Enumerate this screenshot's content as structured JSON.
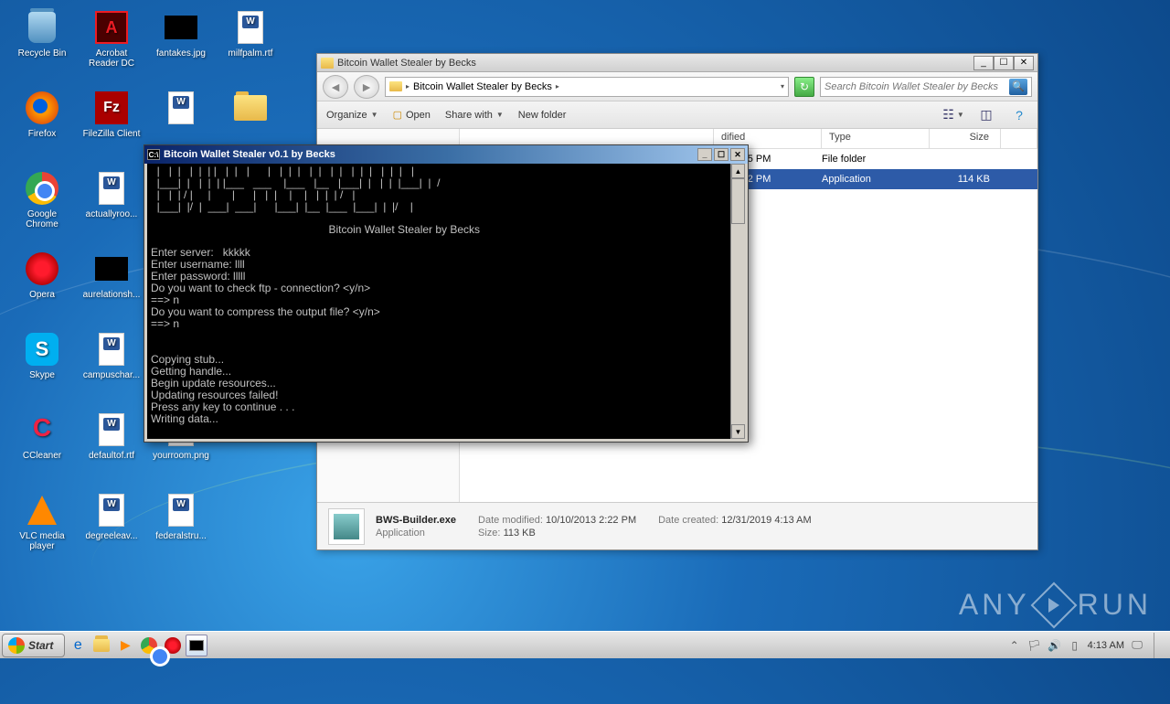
{
  "desktop": {
    "icons": [
      {
        "label": "Recycle Bin",
        "type": "recycle-bin"
      },
      {
        "label": "Acrobat Reader DC",
        "type": "adobe"
      },
      {
        "label": "fantakes.jpg",
        "type": "black"
      },
      {
        "label": "milfpalm.rtf",
        "type": "word"
      },
      {
        "label": "Firefox",
        "type": "firefox"
      },
      {
        "label": "FileZilla Client",
        "type": "filezilla"
      },
      {
        "label": "",
        "type": "word"
      },
      {
        "label": "",
        "type": "folder"
      },
      {
        "label": "Google Chrome",
        "type": "chrome"
      },
      {
        "label": "actuallyroo...",
        "type": "word"
      },
      {
        "label": "",
        "type": ""
      },
      {
        "label": "",
        "type": ""
      },
      {
        "label": "Opera",
        "type": "opera"
      },
      {
        "label": "aurelationsh...",
        "type": "black"
      },
      {
        "label": "",
        "type": ""
      },
      {
        "label": "",
        "type": ""
      },
      {
        "label": "Skype",
        "type": "skype"
      },
      {
        "label": "campuschar...",
        "type": "word"
      },
      {
        "label": "",
        "type": ""
      },
      {
        "label": "",
        "type": ""
      },
      {
        "label": "CCleaner",
        "type": "ccleaner"
      },
      {
        "label": "defaultof.rtf",
        "type": "word"
      },
      {
        "label": "yourroom.png",
        "type": "png"
      },
      {
        "label": "",
        "type": ""
      },
      {
        "label": "VLC media player",
        "type": "vlc"
      },
      {
        "label": "degreeleav...",
        "type": "word"
      },
      {
        "label": "federalstru...",
        "type": "word"
      }
    ]
  },
  "explorer": {
    "title": "Bitcoin Wallet Stealer by Becks",
    "address": "Bitcoin Wallet Stealer by Becks",
    "search_placeholder": "Search Bitcoin Wallet Stealer by Becks",
    "toolbar": {
      "organize": "Organize",
      "open": "Open",
      "share": "Share with",
      "newfolder": "New folder"
    },
    "columns": {
      "name": "",
      "date": "dified",
      "type": "Type",
      "size": "Size"
    },
    "rows": [
      {
        "name": "",
        "date": "019 3:45 PM",
        "type": "File folder",
        "size": "",
        "selected": false
      },
      {
        "name": "",
        "date": "013 2:22 PM",
        "type": "Application",
        "size": "114 KB",
        "selected": true
      }
    ],
    "details": {
      "name": "BWS-Builder.exe",
      "type": "Application",
      "modified_label": "Date modified:",
      "modified": "10/10/2013 2:22 PM",
      "created_label": "Date created:",
      "created": "12/31/2019 4:13 AM",
      "size_label": "Size:",
      "size": "113 KB"
    }
  },
  "console": {
    "title": "Bitcoin Wallet Stealer v0.1 by Becks",
    "ascii_top": "  |   |  |   |  |  | |   |  |   |      |   |  |  |   |  |   |  |   |  |  |   |  |  |   |\n  |___|  |   |  |  | |___   ___    |___   |__   |___|  |   |  |  |___|  |  /\n  |   |  | / |     |       |      |   |  |    |    |   |  |  | /   |      \n  |___|  |/  |  ___|  ___|      |___|  |__  |___  |___|  |  |/    |      ",
    "subtitle": "Bitcoin Wallet Stealer by Becks",
    "body": "Enter server:   kkkkk\nEnter username: llll\nEnter password: lllll\nDo you want to check ftp - connection? <y/n>\n==> n\nDo you want to compress the output file? <y/n>\n==> n\n\n\nCopying stub...\nGetting handle...\nBegin update resources...\nUpdating resources failed!\nPress any key to continue . . .\nWriting data..."
  },
  "taskbar": {
    "start": "Start",
    "time": "4:13 AM"
  },
  "watermark": {
    "text": "ANY",
    "text2": "RUN"
  }
}
